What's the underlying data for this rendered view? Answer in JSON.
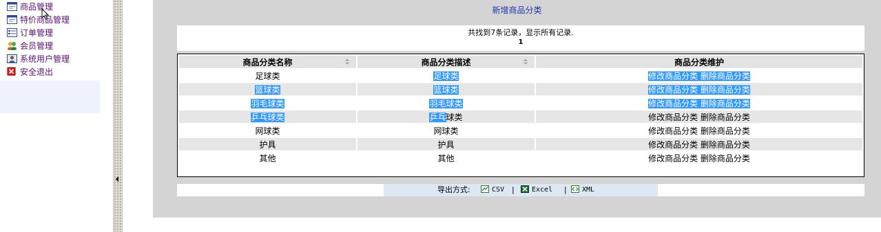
{
  "nav": {
    "items": [
      {
        "label": "商品管理"
      },
      {
        "label": "特价商品管理"
      },
      {
        "label": "订单管理"
      },
      {
        "label": "会员管理"
      },
      {
        "label": "系统用户管理"
      },
      {
        "label": "安全退出"
      }
    ]
  },
  "page": {
    "title": "新增商品分类",
    "summary": "共找到7条记录，显示所有记录.",
    "page_number": "1"
  },
  "table": {
    "headers": [
      "商品分类名称",
      "商品分类描述",
      "商品分类维护"
    ],
    "rows": [
      {
        "name": "足球类",
        "desc": "足球类",
        "edit": "修改商品分类",
        "delete": "删除商品分类"
      },
      {
        "name": "篮球类",
        "desc": "篮球类",
        "edit": "修改商品分类",
        "delete": "删除商品分类"
      },
      {
        "name": "羽毛球类",
        "desc": "羽毛球类",
        "edit": "修改商品分类",
        "delete": "删除商品分类"
      },
      {
        "name": "乒乓球类",
        "desc": "乒乓球类",
        "edit": "修改商品分类",
        "delete": "删除商品分类"
      },
      {
        "name": "网球类",
        "desc": "网球类",
        "edit": "修改商品分类",
        "delete": "删除商品分类"
      },
      {
        "name": "护具",
        "desc": "护具",
        "edit": "修改商品分类",
        "delete": "删除商品分类"
      },
      {
        "name": "其他",
        "desc": "其他",
        "edit": "修改商品分类",
        "delete": "删除商品分类"
      }
    ]
  },
  "export": {
    "label": "导出方式:",
    "csv": "CSV",
    "excel": "Excel",
    "xml": "XML",
    "separator": "|"
  },
  "colors": {
    "nav_text": "#5a0f78",
    "title_text": "#1a39a8",
    "selection": "#3399ff",
    "main_bg": "#d4d4d4"
  }
}
